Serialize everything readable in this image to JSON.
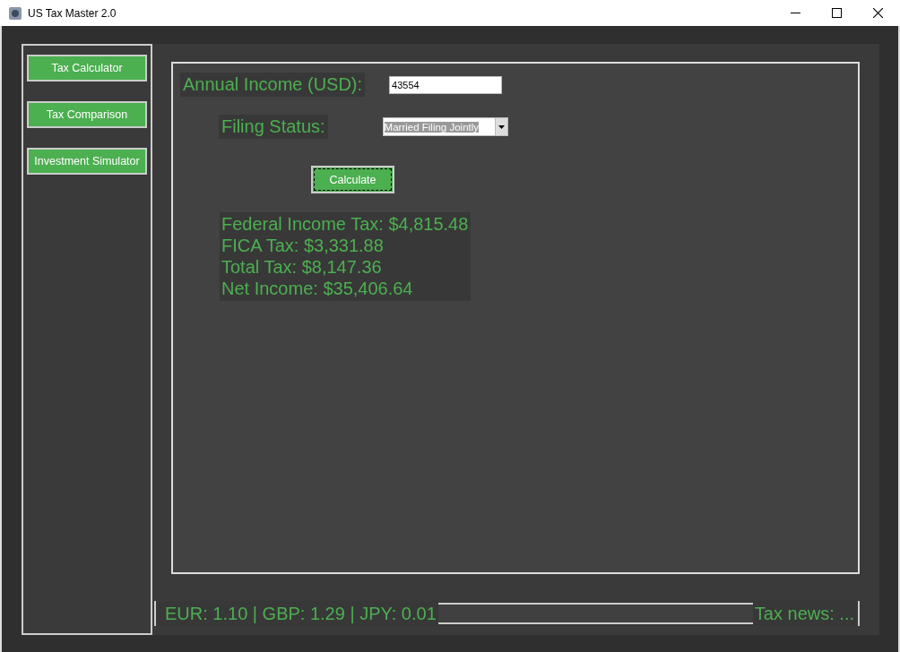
{
  "window": {
    "title": "US Tax Master 2.0"
  },
  "sidebar": {
    "items": [
      {
        "label": "Tax Calculator"
      },
      {
        "label": "Tax Comparison"
      },
      {
        "label": "Investment Simulator"
      }
    ]
  },
  "form": {
    "income_label": "Annual Income (USD):",
    "income_value": "43554",
    "filing_label": "Filing Status:",
    "filing_value": "Married Filing Jointly",
    "calculate_button": "Calculate"
  },
  "results": [
    "Federal Income Tax: $4,815.48",
    "FICA Tax: $3,331.88",
    "Total Tax: $8,147.36",
    "Net Income: $35,406.64"
  ],
  "status_bar": {
    "rates": "EUR: 1.10 | GBP: 1.29 | JPY: 0.01",
    "news": "Tax news: ..."
  }
}
